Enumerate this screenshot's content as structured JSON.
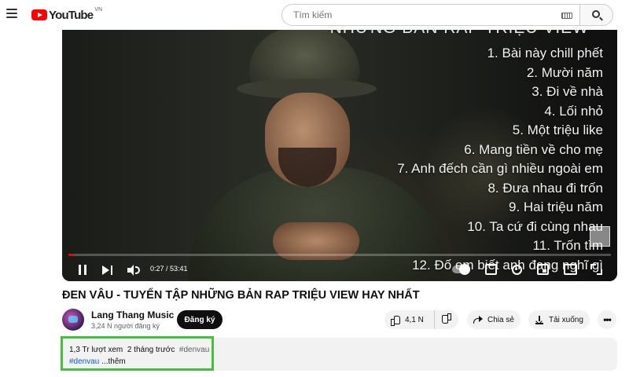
{
  "header": {
    "logo_text": "YouTube",
    "logo_region": "VN",
    "search_placeholder": "Tìm kiếm"
  },
  "player": {
    "overlay_title": "NHỮNG BẢN RAP TRIỆU VIEW",
    "tracklist": [
      "1. Bài này chill phết",
      "2. Mười năm",
      "3. Đi về nhà",
      "4. Lối nhỏ",
      "5. Một triệu like",
      "6. Mang tiền về cho mẹ",
      "7. Anh đếch cần gì nhiều ngoài em",
      "8. Đưa nhau đi trốn",
      "9. Hai triệu năm",
      "10. Ta cứ đi cùng nhau",
      "11. Trốn tìm",
      "12. Đố em biết anh đang nghĩ gì"
    ],
    "time_display": "0:27 / 53:41",
    "progress_fraction": 0.0084,
    "progress_color": "#ff0000"
  },
  "video": {
    "title": "ĐEN VÂU - TUYỂN TẬP NHỮNG BẢN RAP TRIỆU VIEW HAY NHẤT"
  },
  "channel": {
    "name": "Lang Thang Music",
    "subscribers": "3,24 N người đăng ký",
    "subscribe_label": "Đăng ký"
  },
  "actions": {
    "like_count": "4,1 N",
    "share_label": "Chia sẻ",
    "download_label": "Tải xuống",
    "more_label": "•••"
  },
  "description": {
    "views": "1,3 Tr lượt xem",
    "time_ago": "2 tháng trước",
    "hashtag_top": "#denvau",
    "hashtag": "#denvau",
    "more_text": "...thêm",
    "highlight_color": "#44c13c"
  }
}
